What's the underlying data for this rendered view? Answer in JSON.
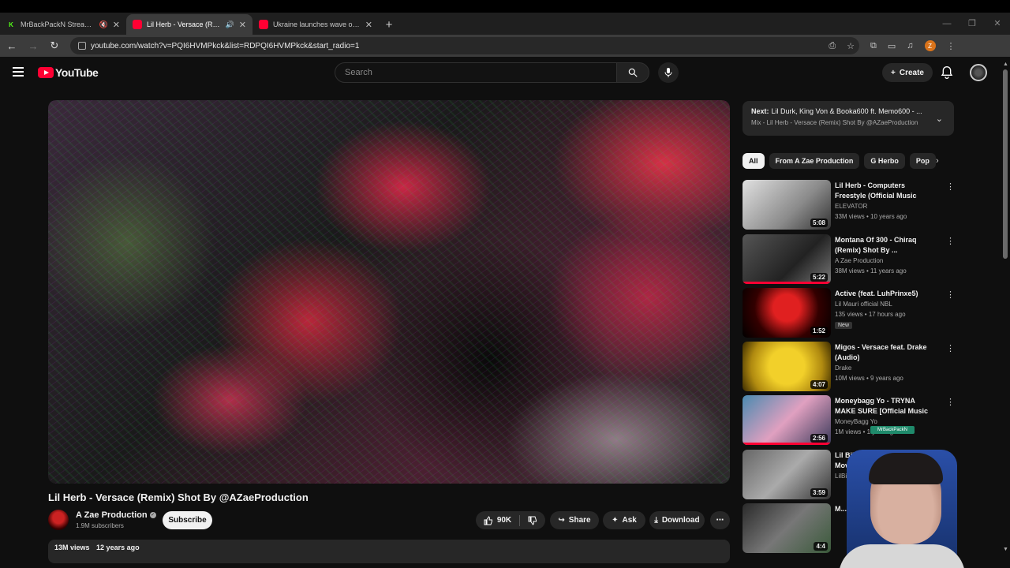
{
  "browser": {
    "tabs": [
      {
        "title": "MrBackPackN Stream - Wa",
        "favicon": "K",
        "favicon_color": "#53fc18",
        "active": false
      },
      {
        "title": "Lil Herb - Versace (Remix) Sh",
        "favicon": "",
        "favicon_color": "#ff0033",
        "active": true
      },
      {
        "title": "Ukraine launches wave of drone",
        "favicon": "",
        "favicon_color": "#ff0033",
        "active": false
      }
    ],
    "new_tab": "+",
    "url": "youtube.com/watch?v=PQI6HVMPkck&list=RDPQI6HVMPkck&start_radio=1",
    "profile_initial": "Z"
  },
  "header": {
    "logo_text": "YouTube",
    "search_placeholder": "Search",
    "create_label": "Create"
  },
  "video": {
    "title": "Lil Herb - Versace (Remix) Shot By @AZaeProduction",
    "channel": "A Zae Production",
    "subscribers": "1.9M subscribers",
    "subscribe_label": "Subscribe",
    "likes": "90K",
    "share_label": "Share",
    "ask_label": "Ask",
    "download_label": "Download",
    "views": "13M views",
    "age": "12 years ago"
  },
  "up_next": {
    "prefix": "Next:",
    "title": "Lil Durk, King Von & Booka600 ft. Memo600 - ...",
    "mix": "Mix - Lil Herb - Versace (Remix) Shot By @AZaeProduction"
  },
  "chips": [
    "All",
    "From A Zae Production",
    "G Herbo",
    "Pop"
  ],
  "recommendations": [
    {
      "title": "Lil Herb - Computers Freestyle (Official Music Video)",
      "channel": "ELEVATOR",
      "meta": "33M views • 10 years ago",
      "duration": "5:08",
      "thumb": "linear-gradient(135deg,#e0e0e0,#8a8a8a 60%,#333)",
      "progress": 0
    },
    {
      "title": "Montana Of 300 - Chiraq (Remix) Shot By ...",
      "channel": "A Zae Production",
      "meta": "38M views • 11 years ago",
      "duration": "5:22",
      "thumb": "linear-gradient(135deg,#555,#222 60%,#777)",
      "progress": 1
    },
    {
      "title": "Active (feat. LuhPrinxe5)",
      "channel": "Lil Mauri official NBL",
      "meta": "135 views • 17 hours ago",
      "duration": "1:52",
      "badge": "New",
      "thumb": "radial-gradient(circle at 50% 40%,#e02020 0 25%,#300 60%,#000)",
      "progress": 0
    },
    {
      "title": "Migos - Versace feat. Drake (Audio)",
      "channel": "Drake",
      "meta": "10M views • 9 years ago",
      "duration": "4:07",
      "thumb": "radial-gradient(circle,#f2d02a 0 35%,#b08a10 70%,#3a2a00)",
      "progress": 0
    },
    {
      "title": "Moneybagg Yo - TRYNA MAKE SURE [Official Music Video]",
      "channel": "MoneyBagg Yo",
      "meta": "1M views • 1 year ago",
      "duration": "2:56",
      "thumb": "linear-gradient(135deg,#4a8ab0,#e0a0c0 50%,#3a3a5a)",
      "progress": 1
    },
    {
      "title": "Lil Bibby Ft. King Louie - We Mov...",
      "channel": "LilBibby",
      "meta": "",
      "duration": "3:59",
      "thumb": "linear-gradient(135deg,#666,#aaa 50%,#333)",
      "progress": 0
    },
    {
      "title": "M...",
      "channel": "",
      "meta": "",
      "duration": "4:4",
      "thumb": "linear-gradient(135deg,#2a2a2a,#777 50%,#3a5a3a)",
      "progress": 0
    }
  ],
  "webcam": {
    "tag": "MrBackPackN"
  }
}
